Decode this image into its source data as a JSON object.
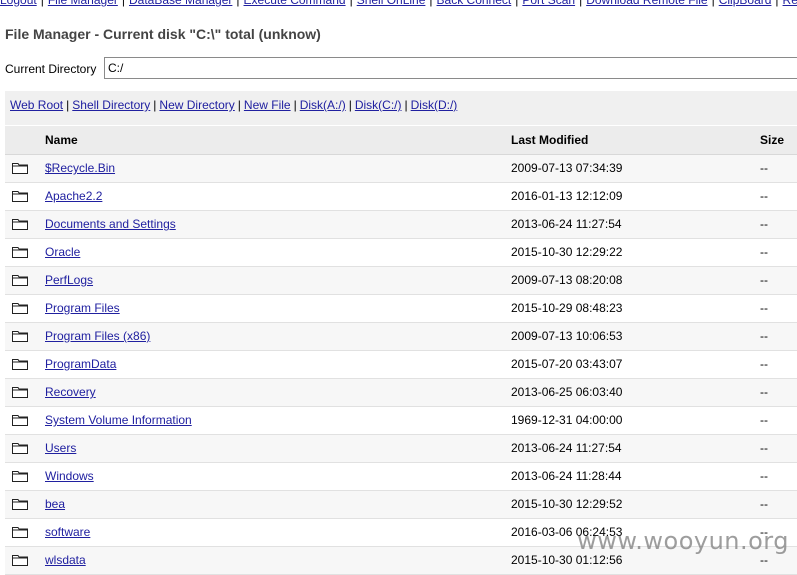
{
  "nav": {
    "items": [
      "Logout",
      "File Manager",
      "DataBase Manager",
      "Execute Command",
      "Shell OnLine",
      "Back Connect",
      "Port Scan",
      "Download Remote File",
      "ClipBoard",
      "Re"
    ]
  },
  "title": "File Manager - Current disk \"C:\\\" total (unknow)",
  "current_directory": {
    "label": "Current Directory",
    "value": "C:/"
  },
  "actions": [
    "Web Root",
    "Shell Directory",
    "New Directory",
    "New File",
    "Disk(A:/)",
    "Disk(C:/)",
    "Disk(D:/)"
  ],
  "table": {
    "headers": {
      "name": "Name",
      "modified": "Last Modified",
      "size": "Size"
    },
    "rows": [
      {
        "name": "$Recycle.Bin",
        "modified": "2009-07-13 07:34:39",
        "size": "--"
      },
      {
        "name": "Apache2.2",
        "modified": "2016-01-13 12:12:09",
        "size": "--"
      },
      {
        "name": "Documents and Settings",
        "modified": "2013-06-24 11:27:54",
        "size": "--"
      },
      {
        "name": "Oracle",
        "modified": "2015-10-30 12:29:22",
        "size": "--"
      },
      {
        "name": "PerfLogs",
        "modified": "2009-07-13 08:20:08",
        "size": "--"
      },
      {
        "name": "Program Files",
        "modified": "2015-10-29 08:48:23",
        "size": "--"
      },
      {
        "name": "Program Files (x86)",
        "modified": "2009-07-13 10:06:53",
        "size": "--"
      },
      {
        "name": "ProgramData",
        "modified": "2015-07-20 03:43:07",
        "size": "--"
      },
      {
        "name": "Recovery",
        "modified": "2013-06-25 06:03:40",
        "size": "--"
      },
      {
        "name": "System Volume Information",
        "modified": "1969-12-31 04:00:00",
        "size": "--"
      },
      {
        "name": "Users",
        "modified": "2013-06-24 11:27:54",
        "size": "--"
      },
      {
        "name": "Windows",
        "modified": "2013-06-24 11:28:44",
        "size": "--"
      },
      {
        "name": "bea",
        "modified": "2015-10-30 12:29:52",
        "size": "--"
      },
      {
        "name": "software",
        "modified": "2016-03-06 06:24:53",
        "size": "--"
      },
      {
        "name": "wlsdata",
        "modified": "2015-10-30 01:12:56",
        "size": "--"
      }
    ]
  },
  "watermark": "www.wooyun.org",
  "colors": {
    "link": "#2020a0",
    "title": "#444444",
    "row_alt": "#f7f7f7",
    "header_bg": "#ececec"
  },
  "icons": {
    "folder": "folder-icon"
  }
}
